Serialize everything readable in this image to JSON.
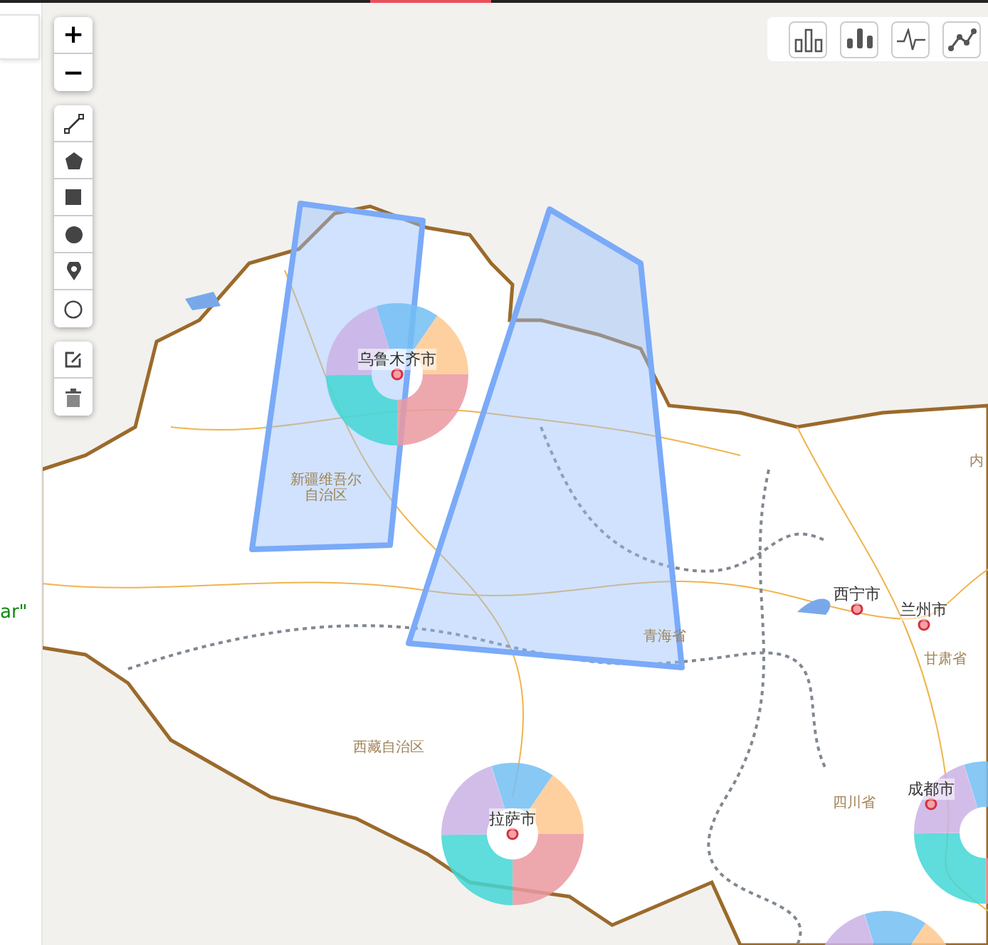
{
  "sidebar": {
    "code_fragment": "ar\""
  },
  "zoom_controls": [
    {
      "label": "+"
    },
    {
      "label": "−"
    }
  ],
  "draw_tools": [
    {
      "kind": "polyline"
    },
    {
      "kind": "polygon"
    },
    {
      "kind": "rectangle"
    },
    {
      "kind": "circle"
    },
    {
      "kind": "marker"
    },
    {
      "kind": "circle-marker"
    }
  ],
  "edit_tools": [
    {
      "kind": "edit"
    },
    {
      "kind": "delete"
    }
  ],
  "chart_toolbar": [
    {
      "kind": "bar"
    },
    {
      "kind": "column"
    },
    {
      "kind": "pulse"
    },
    {
      "kind": "line"
    }
  ],
  "map": {
    "cities": [
      {
        "label": "乌鲁木齐市",
        "chart": true
      },
      {
        "label": "拉萨市",
        "chart": true
      },
      {
        "label": "西宁市",
        "chart": false
      },
      {
        "label": "兰州市",
        "chart": false
      },
      {
        "label": "成都市",
        "chart": true
      }
    ],
    "regions": [
      {
        "label": "新疆维吾尔自治区"
      },
      {
        "label": "西藏自治区"
      },
      {
        "label": "青海省"
      },
      {
        "label": "甘肃省"
      },
      {
        "label": "四川省"
      },
      {
        "label": "内"
      }
    ],
    "drawn_shapes": [
      {
        "kind": "polygon"
      },
      {
        "kind": "polygon"
      }
    ]
  }
}
